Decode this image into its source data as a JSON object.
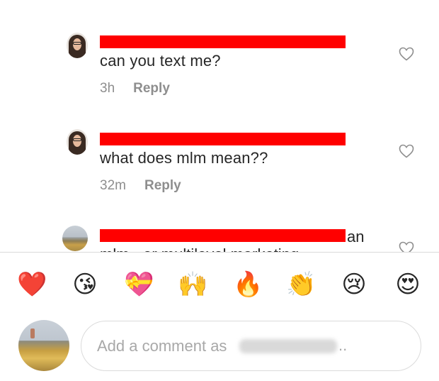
{
  "comments": [
    {
      "text": "can you text me?",
      "time": "3h",
      "reply_label": "Reply"
    },
    {
      "text": "what does mlm mean??",
      "time": "32m",
      "reply_label": "Reply"
    },
    {
      "text_fragment": "an",
      "partial_line": "mlm - or multilevel marketing"
    }
  ],
  "reactions": [
    {
      "icon": "red-heart-emoji",
      "glyph": "❤️"
    },
    {
      "icon": "kissing-face-emoji",
      "glyph": "😘"
    },
    {
      "icon": "heart-with-ribbon-emoji",
      "glyph": "💝"
    },
    {
      "icon": "raising-hands-emoji",
      "glyph": "🙌"
    },
    {
      "icon": "fire-emoji",
      "glyph": "🔥"
    },
    {
      "icon": "clapping-hands-emoji",
      "glyph": "👏"
    },
    {
      "icon": "crying-face-emoji",
      "glyph": "😢"
    },
    {
      "icon": "heart-eyes-emoji",
      "glyph": "😍"
    }
  ],
  "composer": {
    "placeholder": "Add a comment as"
  },
  "colors": {
    "redaction": "#ff0000",
    "secondary_text": "#8e8e8e",
    "border": "#dbdbdb"
  }
}
